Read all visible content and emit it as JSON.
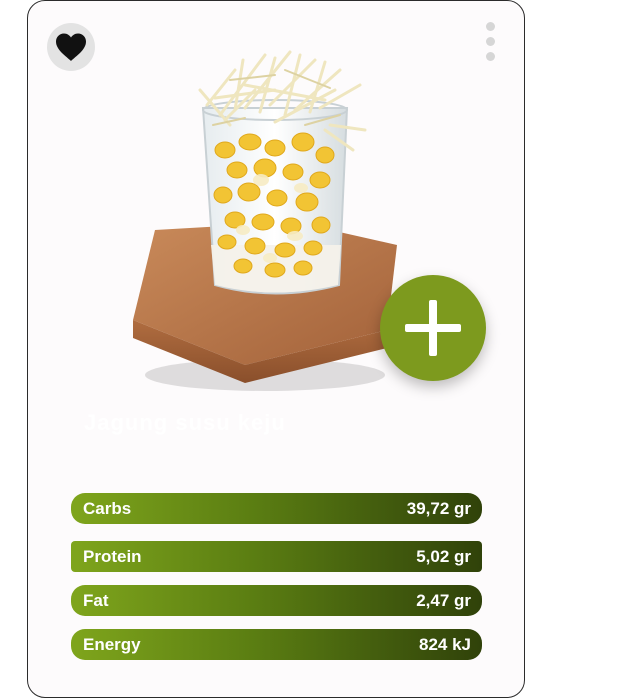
{
  "card": {
    "title": "Jagung susu keju",
    "favorite_icon": "heart-icon",
    "more_icon": "more-vertical-icon",
    "add_icon": "plus-icon"
  },
  "colors": {
    "accent": "#7d9a1e",
    "bar_start": "#7fa51c",
    "bar_end": "#30420a"
  },
  "nutrition": [
    {
      "name": "Carbs",
      "value": "39,72 gr"
    },
    {
      "name": "Protein",
      "value": "5,02 gr"
    },
    {
      "name": "Fat",
      "value": "2,47 gr"
    },
    {
      "name": "Energy",
      "value": "824 kJ"
    }
  ]
}
